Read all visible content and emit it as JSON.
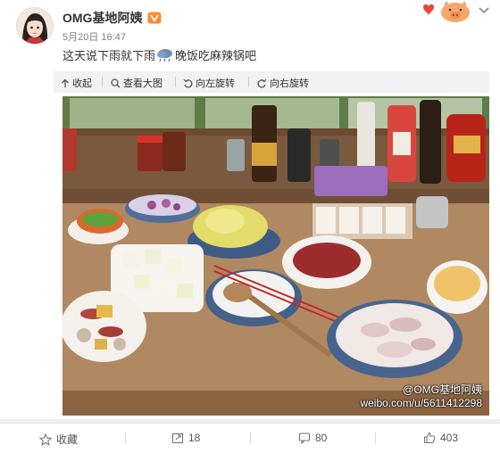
{
  "post": {
    "username": "OMG基地阿姨",
    "time": "5月20日 16:47",
    "text_before": "这天说下雨就下雨",
    "text_after": "晚饭吃麻辣锅吧"
  },
  "toolbar": {
    "collapse": "收起",
    "view_large": "查看大图",
    "rotate_left": "向左旋转",
    "rotate_right": "向右旋转"
  },
  "image": {
    "watermark_handle": "@OMG基地阿姨",
    "watermark_url": "weibo.com/u/5611412298"
  },
  "actions": {
    "favorite": "收藏",
    "repost_count": "18",
    "comment_count": "80",
    "like_count": "403"
  },
  "icons": {
    "vip": "vip-badge-icon",
    "weather": "rain-cloud-icon",
    "collapse": "arrow-up-icon",
    "view": "magnifier-icon",
    "rotate_left": "rotate-left-icon",
    "rotate_right": "rotate-right-icon",
    "favorite": "star-icon",
    "repost": "repost-icon",
    "comment": "comment-icon",
    "like": "thumbs-up-icon"
  }
}
